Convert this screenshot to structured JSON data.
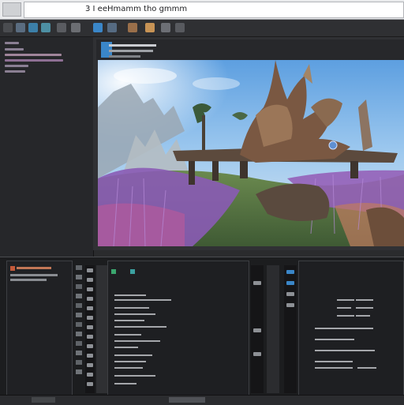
{
  "window": {
    "title": "3 I  eeHmamm tho gmmm"
  },
  "toolbar": {
    "icons": [
      "file-icon",
      "save-icon",
      "undo-icon",
      "redo-icon",
      "move-icon",
      "rotate-icon",
      "scale-icon",
      "snap-icon",
      "camera-icon",
      "light-icon",
      "play-icon",
      "settings-icon"
    ]
  },
  "colors": {
    "chrome_light": "#e9eaec",
    "panel_bg": "#26272a",
    "accent_blue": "#3a86c8",
    "sky": "#7fb6ea",
    "foliage_purple": "#8a5bb5"
  },
  "viewport": {
    "scene": "fantasy-landscape"
  }
}
